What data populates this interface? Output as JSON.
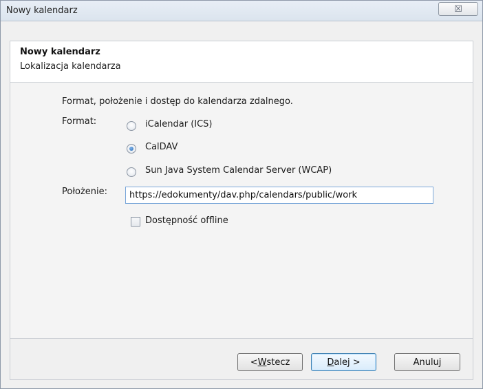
{
  "window": {
    "title": "Nowy kalendarz",
    "close_glyph": "☒"
  },
  "header": {
    "title": "Nowy kalendarz",
    "subtitle": "Lokalizacja kalendarza"
  },
  "content": {
    "description": "Format, położenie i dostęp do kalendarza zdalnego.",
    "format_label": "Format:",
    "formats": [
      {
        "label": "iCalendar (ICS)",
        "selected": false
      },
      {
        "label": "CalDAV",
        "selected": true
      },
      {
        "label": "Sun Java System Calendar Server (WCAP)",
        "selected": false
      }
    ],
    "location_label": "Położenie:",
    "location_value": "https://edokumenty/dav.php/calendars/public/work",
    "offline_label": "Dostępność offline",
    "offline_checked": false
  },
  "buttons": {
    "back_prefix": "< ",
    "back_mnemonic": "W",
    "back_rest": "stecz",
    "next_mnemonic": "D",
    "next_rest": "alej >",
    "cancel": "Anuluj"
  },
  "colors": {
    "accent": "#2a6db5",
    "input_border": "#7aa7d9"
  }
}
